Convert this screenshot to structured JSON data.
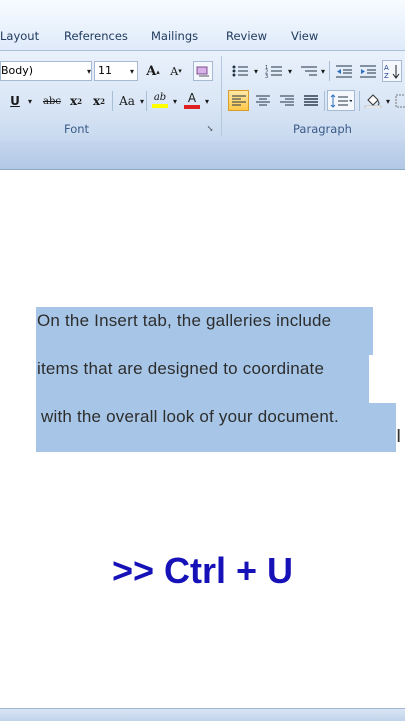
{
  "tabs": [
    "Layout",
    "References",
    "Mailings",
    "Review",
    "View"
  ],
  "font": {
    "name": "Body)",
    "size": "11",
    "grow": "A",
    "shrink": "A",
    "underline": "U",
    "strike": "abc",
    "subscript": "x",
    "superscript": "x",
    "change_case": "Aa",
    "highlight": "ab",
    "font_color": "A",
    "group_label": "Font"
  },
  "paragraph": {
    "group_label": "Paragraph"
  },
  "document": {
    "lines": [
      "On the Insert tab, the galleries include",
      "items that are designed to coordinate",
      "with the overall look of your document."
    ]
  },
  "shortcut": ">> Ctrl + U",
  "colors": {
    "selection": "#a7c6e7",
    "shortcut_text": "#1612b8",
    "ribbon": "#dbe7f6"
  }
}
